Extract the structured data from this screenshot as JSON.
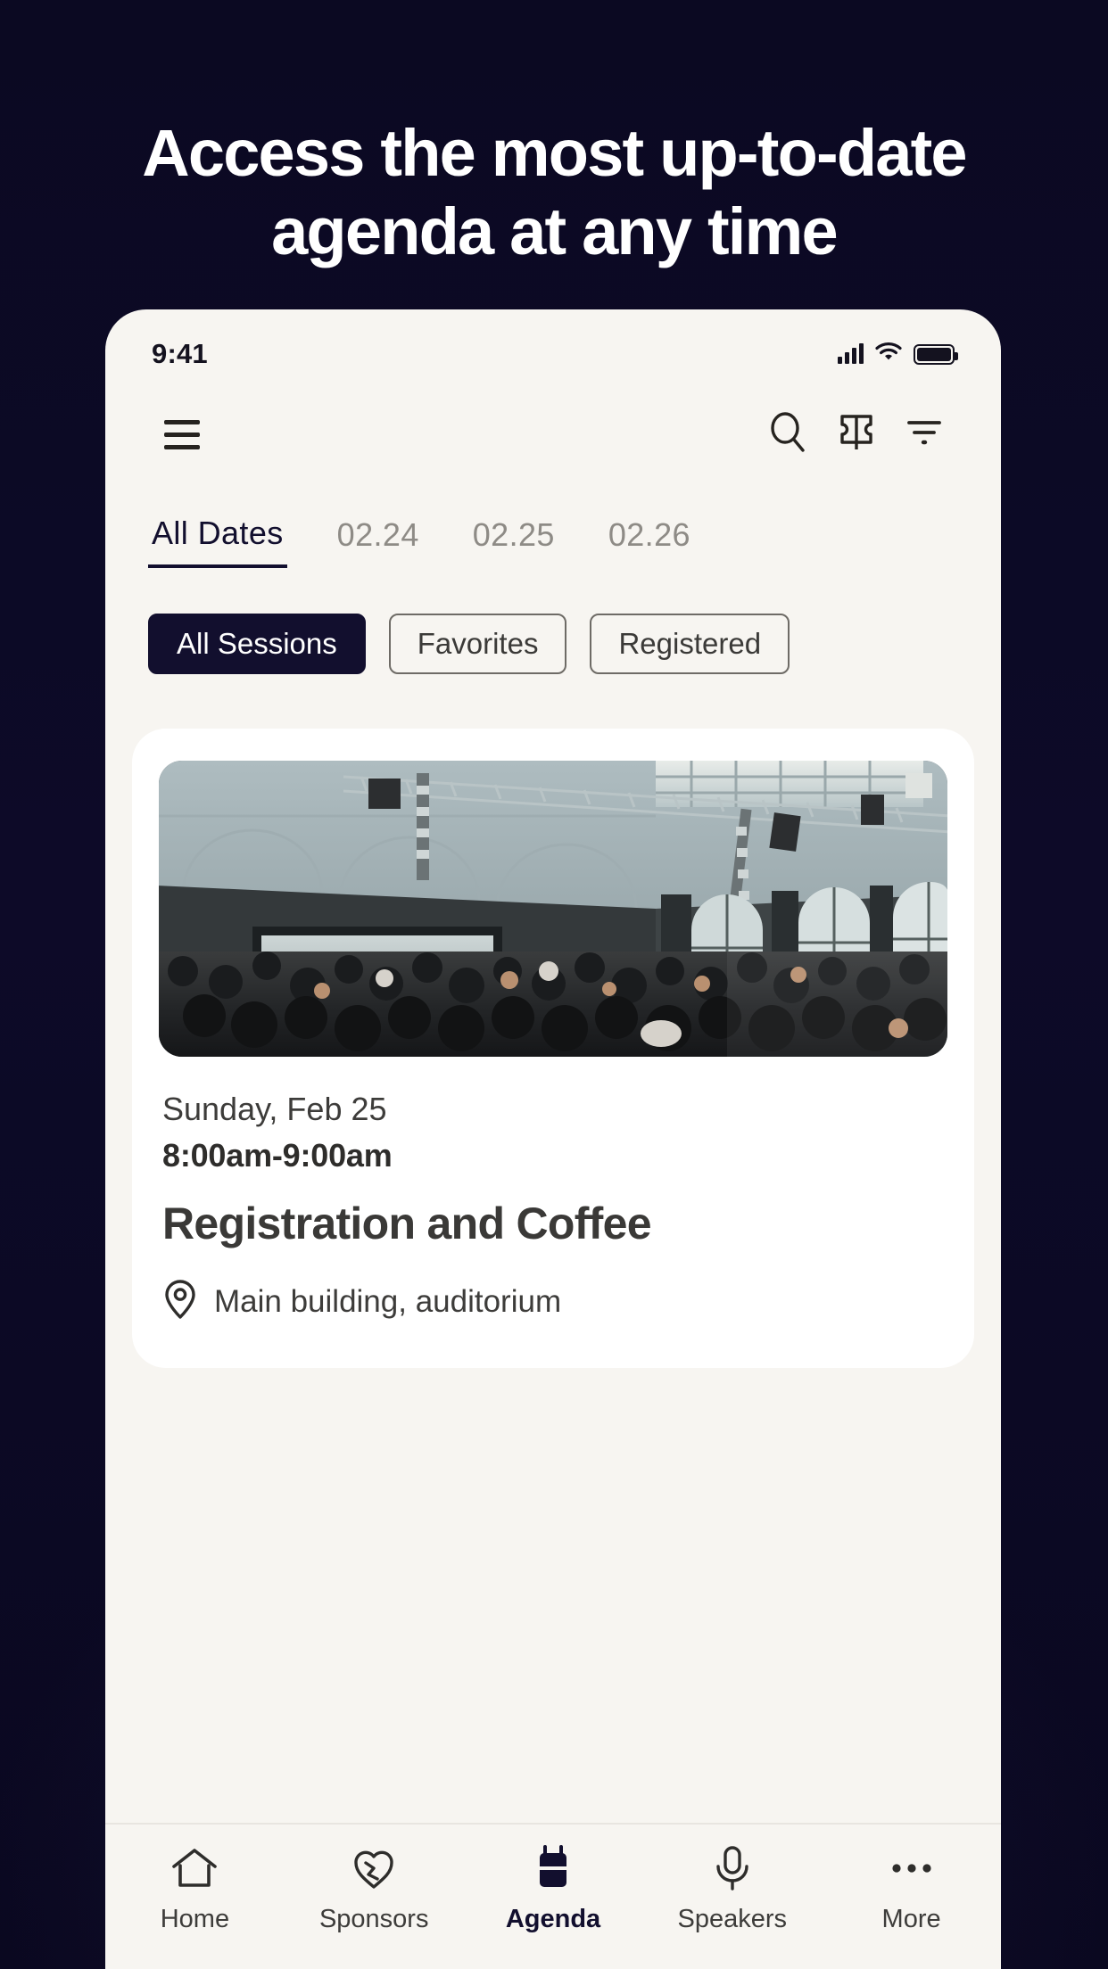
{
  "promo": {
    "headline": "Access the most up-to-date agenda at any time",
    "background_color": "#0c0a26"
  },
  "phone": {
    "status_bar": {
      "time": "9:41",
      "cellular_icon": "signal-bars-icon",
      "wifi_icon": "wifi-icon",
      "battery_icon": "battery-icon"
    },
    "toolbar": {
      "menu_icon": "hamburger-menu-icon",
      "search_icon": "search-icon",
      "ticket_icon": "ticket-icon",
      "filter_icon": "filter-icon"
    },
    "date_tabs": [
      {
        "label": "All Dates",
        "active": true
      },
      {
        "label": "02.24",
        "active": false
      },
      {
        "label": "02.25",
        "active": false
      },
      {
        "label": "02.26",
        "active": false
      }
    ],
    "filter_chips": [
      {
        "label": "All Sessions",
        "active": true
      },
      {
        "label": "Favorites",
        "active": false
      },
      {
        "label": "Registered",
        "active": false
      }
    ],
    "sessions": [
      {
        "date": "Sunday, Feb 25",
        "time": "8:00am-9:00am",
        "title": "Registration and Coffee",
        "location": "Main building, auditorium",
        "location_icon": "map-pin-icon",
        "photo_alt": "conference-hall-crowd-photo"
      }
    ],
    "bottom_nav": [
      {
        "label": "Home",
        "icon": "home-icon",
        "active": false
      },
      {
        "label": "Sponsors",
        "icon": "sponsors-heart-icon",
        "active": false
      },
      {
        "label": "Agenda",
        "icon": "calendar-icon",
        "active": true
      },
      {
        "label": "Speakers",
        "icon": "microphone-icon",
        "active": false
      },
      {
        "label": "More",
        "icon": "ellipsis-icon",
        "active": false
      }
    ],
    "colors": {
      "accent_dark": "#120f2e",
      "app_background": "#f7f5f1",
      "card_background": "#ffffff",
      "muted_text": "#8e8b86"
    }
  }
}
